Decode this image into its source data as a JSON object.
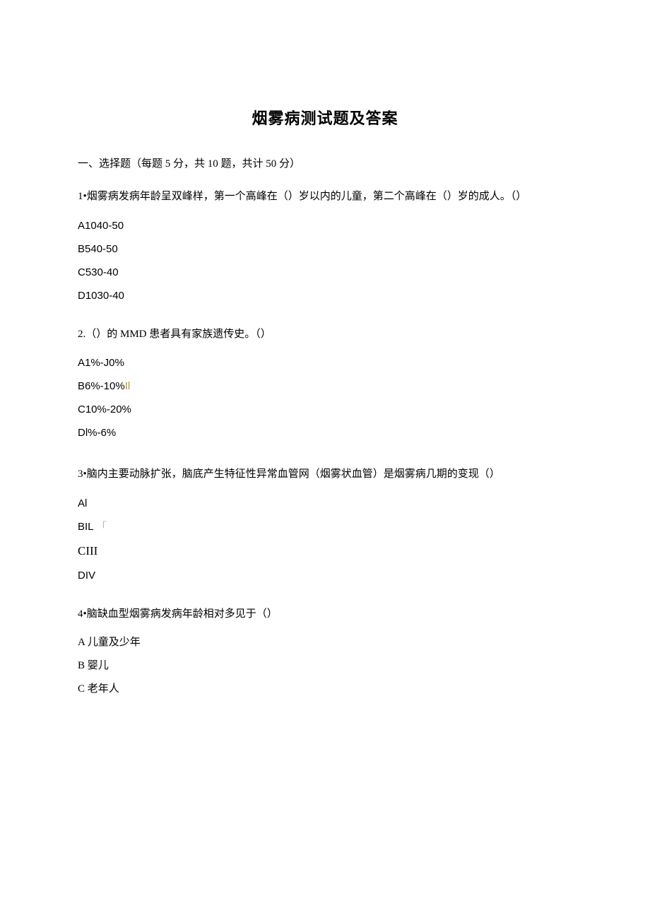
{
  "title": "烟雾病测试题及答案",
  "section": "一、选择题（每题 5 分，共 10 题，共计 50 分）",
  "q1": {
    "stem": "1•烟雾病发病年龄呈双峰样，第一个高峰在（）岁以内的儿童，第二个高峰在（）岁的成人。（）",
    "a": "A1040-50",
    "b": "B540-50",
    "c": "C530-40",
    "d": "D1030-40"
  },
  "q2": {
    "stem": "2.（）的 MMD 患者具有家族遗传史。（）",
    "a": "A1%-J0%",
    "b": "B6%-10%",
    "bmark": "Il",
    "c": "C10%-20%",
    "d": "Dl%-6%"
  },
  "q3": {
    "stem": "3•脑内主要动脉扩张，脑底产生特征性异常血管网（烟雾状血管）是烟雾病几期的变现（）",
    "a": "Al",
    "b": "BIL",
    "bmark": "「",
    "c": "CIII",
    "d": "DIV"
  },
  "q4": {
    "stem": "4•脑缺血型烟雾病发病年龄相对多见于（）",
    "a": "A 儿童及少年",
    "b": "B 婴儿",
    "c": "C 老年人"
  }
}
